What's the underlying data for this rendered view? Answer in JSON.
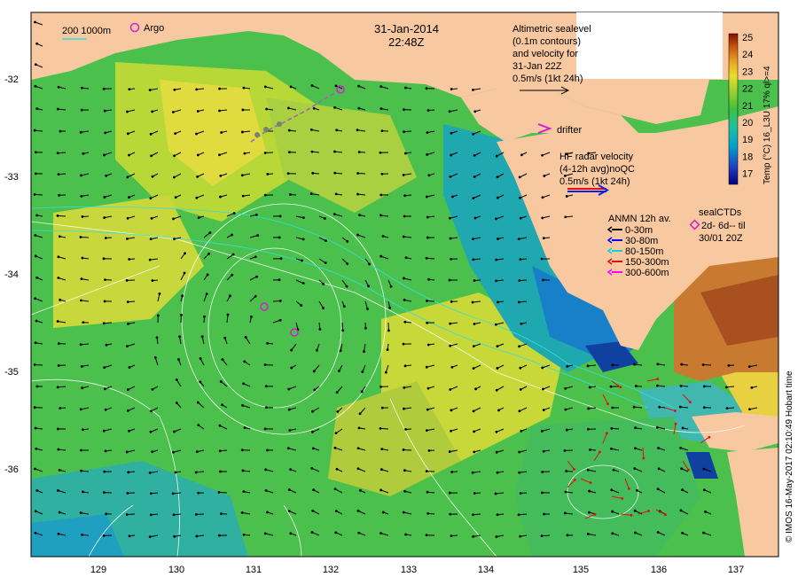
{
  "header": {
    "date": "31-Jan-2014",
    "time": "22:48Z"
  },
  "scale_legend": {
    "label": "200  1000m",
    "argo_label": "Argo"
  },
  "altimetry": {
    "line1": "Altimetric sealevel",
    "line2": "(0.1m contours)",
    "line3": "and velocity for",
    "line4": "31-Jan 22Z",
    "line5": "0.5m/s (1kt 24h)"
  },
  "drifter_label": "drifter",
  "hf_radar": {
    "line1": "HF radar velocity",
    "line2": "(4-12h avg)noQC",
    "line3": "0.5m/s (1kt 24h)"
  },
  "anmn": {
    "title": "ANMN 12h av.",
    "items": [
      {
        "label": "0-30m",
        "color": "#000000"
      },
      {
        "label": "30-80m",
        "color": "#0000ff"
      },
      {
        "label": "80-150m",
        "color": "#00d8d8"
      },
      {
        "label": "150-300m",
        "color": "#e01010"
      },
      {
        "label": "300-600m",
        "color": "#ff00ff"
      }
    ]
  },
  "sealctds": {
    "title": "sealCTDs",
    "line1": "2d- 6d-- til",
    "line2": "30/01 20Z"
  },
  "colorbar": {
    "title": "Temp (°C) 16_L3U 17% ql>=4",
    "ticks": [
      "25",
      "24",
      "23",
      "22",
      "21",
      "20",
      "19",
      "18",
      "17"
    ]
  },
  "credit": "© IMOS 16-May-2017 02:10:49 Hobart time",
  "axes": {
    "x_ticks": [
      "129",
      "130",
      "131",
      "132",
      "133",
      "134",
      "135",
      "136",
      "137"
    ],
    "y_ticks": [
      "-32",
      "-33",
      "-34",
      "-35",
      "-36"
    ]
  },
  "colors": {
    "land": "#f8c8a0",
    "sst_warm": "#e6d83c",
    "sst_mid": "#4cc04c",
    "sst_cool": "#20a8b0",
    "hf_radar_arrow": "#e01010",
    "argo_marker": "#d020d0"
  }
}
